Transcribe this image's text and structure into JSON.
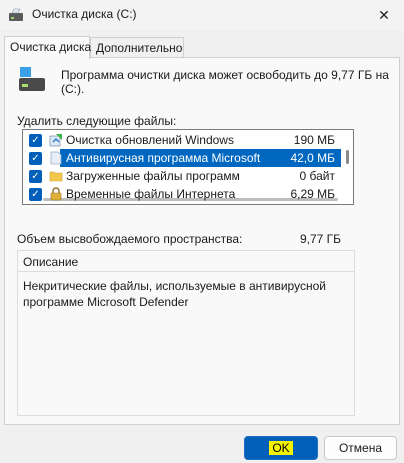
{
  "window": {
    "title": "Очистка диска  (C:)",
    "close_glyph": "✕"
  },
  "tabs": [
    {
      "label": "Очистка диска",
      "active": true
    },
    {
      "label": "Дополнительно",
      "active": false
    }
  ],
  "intro_text": "Программа очистки диска может освободить до 9,77 ГБ на  (C:).",
  "files_label": "Удалить следующие файлы:",
  "files": [
    {
      "name": "Очистка обновлений Windows",
      "size": "190 МБ",
      "checked": true,
      "icon": "windows-update-icon"
    },
    {
      "name": "Антивирусная программа Microsoft ...",
      "size": "42,0 МБ",
      "checked": true,
      "icon": "file-icon",
      "selected": true
    },
    {
      "name": "Загруженные файлы программ",
      "size": "0 байт",
      "checked": true,
      "icon": "folder-icon"
    },
    {
      "name": "Временные файлы Интернета",
      "size": "6,29 МБ",
      "checked": true,
      "icon": "lock-icon"
    }
  ],
  "freed_label": "Объем высвобождаемого пространства:",
  "freed_value": "9,77 ГБ",
  "description": {
    "title": "Описание",
    "text": "Некритические файлы, используемые в антивирусной программе Microsoft Defender"
  },
  "buttons": {
    "ok": "OK",
    "cancel": "Отмена"
  },
  "colors": {
    "accent": "#005fb8",
    "selection": "#0067c0",
    "highlight": "#f4f400"
  }
}
